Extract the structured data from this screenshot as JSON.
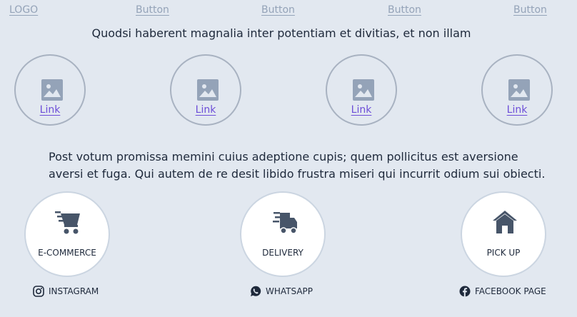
{
  "nav": {
    "logo": "LOGO",
    "buttons": [
      "Button",
      "Button",
      "Button",
      "Button"
    ]
  },
  "headline": "Quodsi haberent magnalia inter potentiam et divitias, et non illam",
  "gallery": {
    "items": [
      {
        "icon": "image-icon",
        "label": "Link"
      },
      {
        "icon": "image-icon",
        "label": "Link"
      },
      {
        "icon": "image-icon",
        "label": "Link"
      },
      {
        "icon": "image-icon",
        "label": "Link"
      }
    ]
  },
  "paragraph": {
    "line1": "Post votum promissa memini cuius adeptione cupis; quem pollicitus est aversione",
    "line2": "aversi et fuga. Qui autem de re desit libido frustra miseri qui incurrit odium sui obiecti."
  },
  "services": [
    {
      "icon": "shopping-cart-icon",
      "label": "E-COMMERCE"
    },
    {
      "icon": "delivery-truck-icon",
      "label": "DELIVERY"
    },
    {
      "icon": "house-icon",
      "label": "PICK UP"
    }
  ],
  "social": [
    {
      "icon": "instagram-icon",
      "label": "INSTAGRAM"
    },
    {
      "icon": "whatsapp-icon",
      "label": "WHATSAPP"
    },
    {
      "icon": "facebook-icon",
      "label": "FACEBOOK PAGE"
    }
  ],
  "colors": {
    "background": "#e2e8f0",
    "link": "#6d4ed8",
    "muted": "#94a3b8",
    "icon": "#475569"
  }
}
